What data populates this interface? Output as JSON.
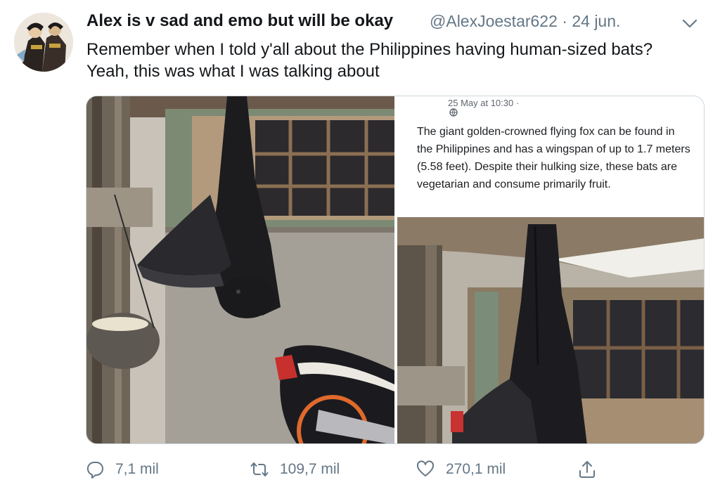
{
  "tweet": {
    "display_name": "Alex is v sad and emo but will be okay",
    "handle": "@AlexJoestar622",
    "separator": "·",
    "date": "24 jun.",
    "text": "Remember when I told y'all about the Philippines having human-sized bats? Yeah, this was what I was talking about",
    "menu_icon": "chevron-down-icon"
  },
  "media": {
    "left_photo_icon": "photo",
    "right_caption": {
      "date": "25 May at 10:30 ·",
      "globe_icon": "globe-icon",
      "text": "The giant golden-crowned flying fox can be found in the Philippines and has a wingspan of up to 1.7 meters (5.58 feet). Despite their hulking size, these bats are vegetarian and consume primarily fruit."
    }
  },
  "actions": {
    "reply_count": "7,1 mil",
    "retweet_count": "109,7 mil",
    "like_count": "270,1 mil",
    "share_icon": "share-icon"
  },
  "colors": {
    "text_primary": "#14171a",
    "text_secondary": "#657786",
    "border": "#ccd6dd"
  }
}
